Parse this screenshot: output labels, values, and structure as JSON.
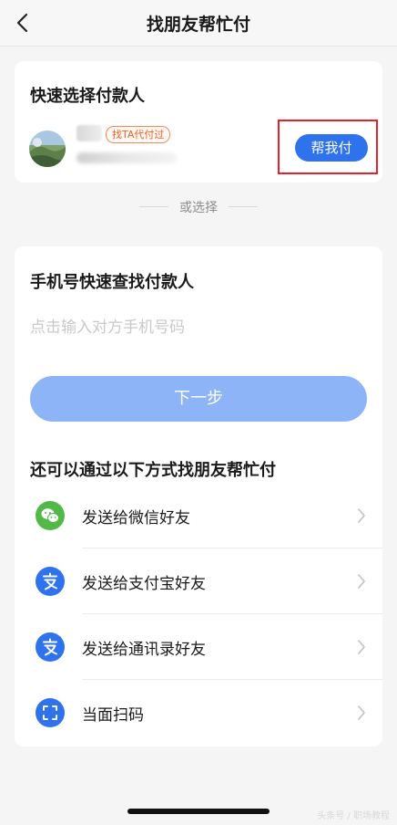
{
  "nav": {
    "title": "找朋友帮忙付",
    "back_icon": "chevron-left-icon"
  },
  "quick": {
    "title": "快速选择付款人",
    "tag": "找TA代付过",
    "help_button": "帮我付"
  },
  "divider": {
    "text": "或选择"
  },
  "phone": {
    "title": "手机号快速查找付款人",
    "placeholder": "点击输入对方手机号码",
    "next_button": "下一步"
  },
  "other": {
    "title": "还可以通过以下方式找朋友帮忙付",
    "options": [
      {
        "label": "发送给微信好友",
        "icon": "wechat-icon",
        "color": "#52b848"
      },
      {
        "label": "发送给支付宝好友",
        "icon": "alipay-icon",
        "color": "#2f72ee"
      },
      {
        "label": "发送给通讯录好友",
        "icon": "alipay-icon",
        "color": "#2f72ee"
      },
      {
        "label": "当面扫码",
        "icon": "scan-icon",
        "color": "#2f72ee"
      }
    ]
  },
  "watermark": "头条号 / 职场教程",
  "colors": {
    "accent": "#2f72ee",
    "highlight": "#e6212a",
    "tag": "#e8632b"
  }
}
